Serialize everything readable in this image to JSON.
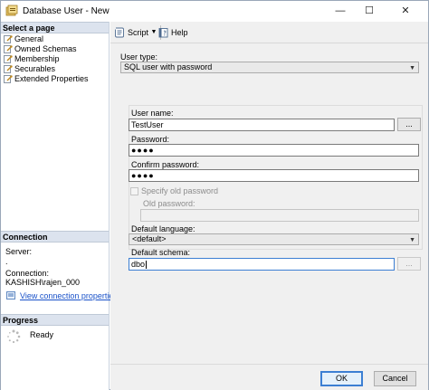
{
  "window": {
    "title": "Database User - New",
    "minimize_glyph": "—",
    "maximize_glyph": "☐",
    "close_glyph": "✕"
  },
  "left_pane": {
    "select_page_header": "Select a page",
    "pages": [
      {
        "label": "General",
        "icon": "page-wrench-icon"
      },
      {
        "label": "Owned Schemas",
        "icon": "page-wrench-icon"
      },
      {
        "label": "Membership",
        "icon": "page-wrench-icon"
      },
      {
        "label": "Securables",
        "icon": "page-wrench-icon"
      },
      {
        "label": "Extended Properties",
        "icon": "page-wrench-icon"
      }
    ],
    "connection_header": "Connection",
    "server_label": "Server:",
    "server_value": ".",
    "connection_label": "Connection:",
    "connection_value": "KASHISH\\rajen_000",
    "view_connection_link": "View connection properties",
    "progress_header": "Progress",
    "progress_status": "Ready"
  },
  "toolbar": {
    "script_label": "Script",
    "dropdown_glyph": "▼",
    "help_label": "Help"
  },
  "form": {
    "user_type_label": "User type:",
    "user_type_value": "SQL user with password",
    "user_name_label": "User name:",
    "user_name_value": "TestUser",
    "password_label": "Password:",
    "password_value": "●●●●",
    "confirm_password_label": "Confirm password:",
    "confirm_password_value": "●●●●",
    "specify_old_password_label": "Specify old password",
    "old_password_label": "Old password:",
    "default_language_label": "Default language:",
    "default_language_value": "<default>",
    "default_schema_label": "Default schema:",
    "default_schema_value": "dbo",
    "ellipsis_label": "...",
    "combo_arrow_glyph": "▼"
  },
  "buttons": {
    "ok_label": "OK",
    "cancel_label": "Cancel"
  },
  "colors": {
    "accent": "#3c7fd3",
    "link": "#1a52c9",
    "section_header_bg": "#dce3ee",
    "panel_bg": "#f0f0f0"
  }
}
